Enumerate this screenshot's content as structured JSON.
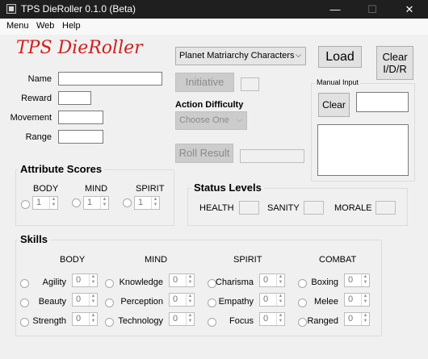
{
  "window": {
    "title": "TPS DieRoller 0.1.0 (Beta)",
    "min_glyph": "—",
    "max_glyph": "☐",
    "close_glyph": "✕"
  },
  "menu": [
    "Menu",
    "Web",
    "Help"
  ],
  "app_title": "TPS DieRoller",
  "fields": {
    "name_label": "Name",
    "reward_label": "Reward",
    "movement_label": "Movement",
    "range_label": "Range"
  },
  "character_select": {
    "value": "Planet Matriarchy Characters",
    "arrow": "⌵"
  },
  "buttons": {
    "load": "Load",
    "clear_idr_line1": "Clear",
    "clear_idr_line2": "I/D/R",
    "initiative": "Initiative",
    "roll_result": "Roll Result",
    "manual_clear": "Clear"
  },
  "action_difficulty": {
    "label": "Action Difficulty",
    "value": "Choose One",
    "arrow": "⌵"
  },
  "manual_input": {
    "title": "Manual Input"
  },
  "attribute_scores": {
    "title": "Attribute Scores",
    "items": [
      {
        "label": "BODY",
        "value": "1"
      },
      {
        "label": "MIND",
        "value": "1"
      },
      {
        "label": "SPIRIT",
        "value": "1"
      }
    ]
  },
  "status_levels": {
    "title": "Status Levels",
    "items": [
      "HEALTH",
      "SANITY",
      "MORALE"
    ]
  },
  "skills": {
    "title": "Skills",
    "columns": [
      {
        "header": "BODY",
        "skills": [
          {
            "name": "Agility",
            "value": "0"
          },
          {
            "name": "Beauty",
            "value": "0"
          },
          {
            "name": "Strength",
            "value": "0"
          }
        ]
      },
      {
        "header": "MIND",
        "skills": [
          {
            "name": "Knowledge",
            "value": "0"
          },
          {
            "name": "Perception",
            "value": "0"
          },
          {
            "name": "Technology",
            "value": "0"
          }
        ]
      },
      {
        "header": "SPIRIT",
        "skills": [
          {
            "name": "Charisma",
            "value": "0"
          },
          {
            "name": "Empathy",
            "value": "0"
          },
          {
            "name": "Focus",
            "value": "0"
          }
        ]
      },
      {
        "header": "COMBAT",
        "skills": [
          {
            "name": "Boxing",
            "value": "0"
          },
          {
            "name": "Melee",
            "value": "0"
          },
          {
            "name": "Ranged",
            "value": "0"
          }
        ]
      }
    ]
  },
  "spin_arrows": "▲▼"
}
